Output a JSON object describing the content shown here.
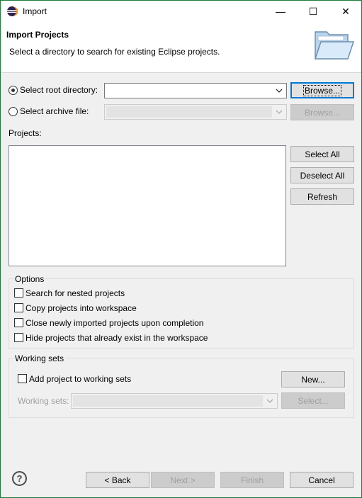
{
  "window": {
    "title": "Import",
    "controls": {
      "minimize": "—",
      "maximize": "☐",
      "close": "✕"
    }
  },
  "header": {
    "title": "Import Projects",
    "subtitle": "Select a directory to search for existing Eclipse projects."
  },
  "source": {
    "root_label": "Select root directory:",
    "root_value": "",
    "root_browse": "Browse...",
    "archive_label": "Select archive file:",
    "archive_value": "",
    "archive_browse": "Browse..."
  },
  "projects": {
    "label": "Projects:",
    "items": [],
    "select_all": "Select All",
    "deselect_all": "Deselect All",
    "refresh": "Refresh"
  },
  "options": {
    "title": "Options",
    "items": [
      {
        "label": "Search for nested projects",
        "checked": false
      },
      {
        "label": "Copy projects into workspace",
        "checked": false
      },
      {
        "label": "Close newly imported projects upon completion",
        "checked": false
      },
      {
        "label": "Hide projects that already exist in the workspace",
        "checked": false
      }
    ]
  },
  "working_sets": {
    "title": "Working sets",
    "add_label": "Add project to working sets",
    "new_button": "New...",
    "sets_label": "Working sets:",
    "sets_value": "",
    "select_button": "Select..."
  },
  "footer": {
    "help_icon": "?",
    "back": "< Back",
    "next": "Next >",
    "finish": "Finish",
    "cancel": "Cancel"
  },
  "colors": {
    "default_button_border": "#0078d7",
    "window_border": "#1d7a3a"
  }
}
